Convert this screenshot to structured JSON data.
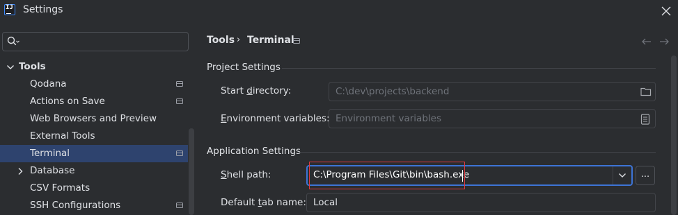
{
  "window": {
    "title": "Settings"
  },
  "sidebar": {
    "search_placeholder": "",
    "group": "Tools",
    "items": [
      {
        "label": "Qodana",
        "modified": true,
        "selected": false,
        "expandable": false
      },
      {
        "label": "Actions on Save",
        "modified": true,
        "selected": false,
        "expandable": false
      },
      {
        "label": "Web Browsers and Preview",
        "modified": false,
        "selected": false,
        "expandable": false
      },
      {
        "label": "External Tools",
        "modified": false,
        "selected": false,
        "expandable": false
      },
      {
        "label": "Terminal",
        "modified": true,
        "selected": true,
        "expandable": false
      },
      {
        "label": "Database",
        "modified": false,
        "selected": false,
        "expandable": true
      },
      {
        "label": "CSV Formats",
        "modified": false,
        "selected": false,
        "expandable": false
      },
      {
        "label": "SSH Configurations",
        "modified": true,
        "selected": false,
        "expandable": false
      }
    ]
  },
  "breadcrumb": {
    "parent": "Tools",
    "separator": "›",
    "current": "Terminal"
  },
  "project_settings": {
    "title": "Project Settings",
    "start_dir": {
      "label_pre": "Start ",
      "label_mnemonic": "d",
      "label_post": "irectory:",
      "value": "C:\\dev\\projects\\backend"
    },
    "env_vars": {
      "label_pre": "",
      "label_mnemonic": "E",
      "label_post": "nvironment variables:",
      "placeholder": "Environment variables"
    }
  },
  "app_settings": {
    "title": "Application Settings",
    "shell_path": {
      "label_pre": "",
      "label_mnemonic": "S",
      "label_post": "hell path:",
      "value": "C:\\Program Files\\Git\\bin\\bash.exe"
    },
    "default_tab": {
      "label_pre": "Default ",
      "label_mnemonic": "t",
      "label_post": "ab name:",
      "value": "Local"
    },
    "browse_label": "..."
  },
  "colors": {
    "accent": "#3d74d6",
    "selection": "#2e436e",
    "highlight_box": "#e0393e"
  }
}
